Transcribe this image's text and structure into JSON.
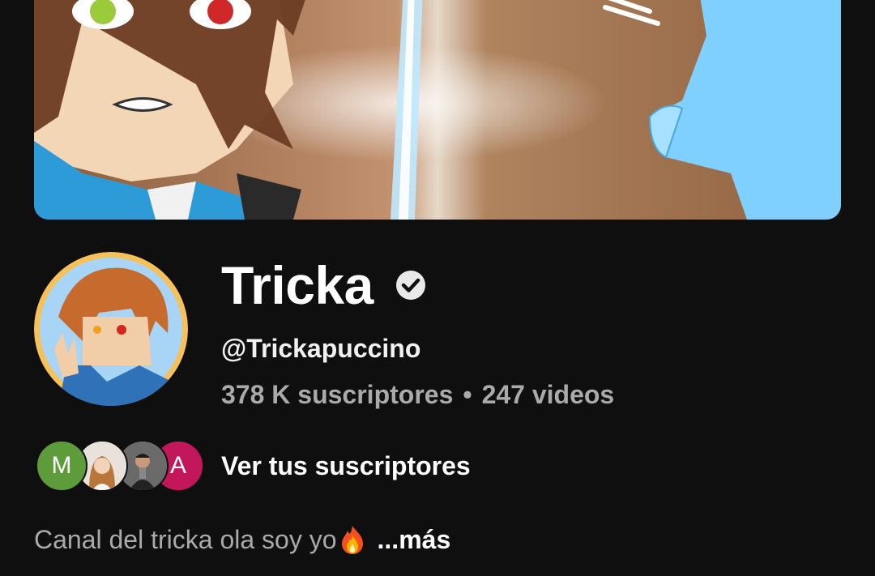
{
  "channel": {
    "name": "Tricka",
    "verified": true,
    "handle": "@Trickapuccino",
    "subscribers": "378 K suscriptores",
    "separator": "•",
    "videos": "247 videos"
  },
  "subscribers_preview": {
    "avatars": [
      {
        "letter": "M",
        "color": "#5e9b3a"
      },
      {
        "photo": true
      },
      {
        "photo": true
      },
      {
        "letter": "A",
        "color": "#c2185b"
      }
    ],
    "link_label": "Ver tus suscriptores"
  },
  "description": {
    "text": "Canal del tricka ola soy yo",
    "emoji": "fire-icon",
    "more_label": "...más"
  },
  "colors": {
    "background": "#0f0f0f",
    "primary_text": "#f1f1f1",
    "secondary_text": "#aaaaaa"
  }
}
